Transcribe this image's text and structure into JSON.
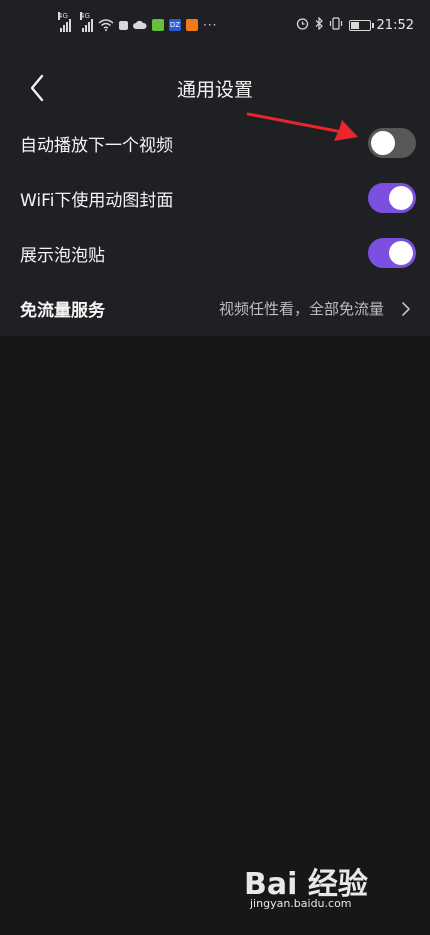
{
  "status_bar": {
    "network_1": "4G",
    "network_2": "4G",
    "app_icon_2": "DZ",
    "more": "···",
    "time": "21:52",
    "battery_level": 0.5,
    "icons": [
      "alarm-icon",
      "bluetooth-icon",
      "vibrate-icon",
      "battery-icon"
    ]
  },
  "header": {
    "title": "通用设置",
    "back_icon": "back-chevron-icon"
  },
  "settings": {
    "rows": [
      {
        "label": "自动播放下一个视频",
        "toggle": false
      },
      {
        "label": "WiFi下使用动图封面",
        "toggle": true
      },
      {
        "label": "展示泡泡贴",
        "toggle": true
      },
      {
        "label": "免流量服务",
        "value": "视频任性看，全部免流量"
      }
    ]
  },
  "colors": {
    "background": "#151719",
    "panel": "#1f2023",
    "toggle_on": "#7b4fe0",
    "toggle_off": "#585858",
    "annotation_arrow": "#e8262b"
  },
  "watermark": {
    "logo": "Bai 经验",
    "url": "jingyan.baidu.com"
  }
}
